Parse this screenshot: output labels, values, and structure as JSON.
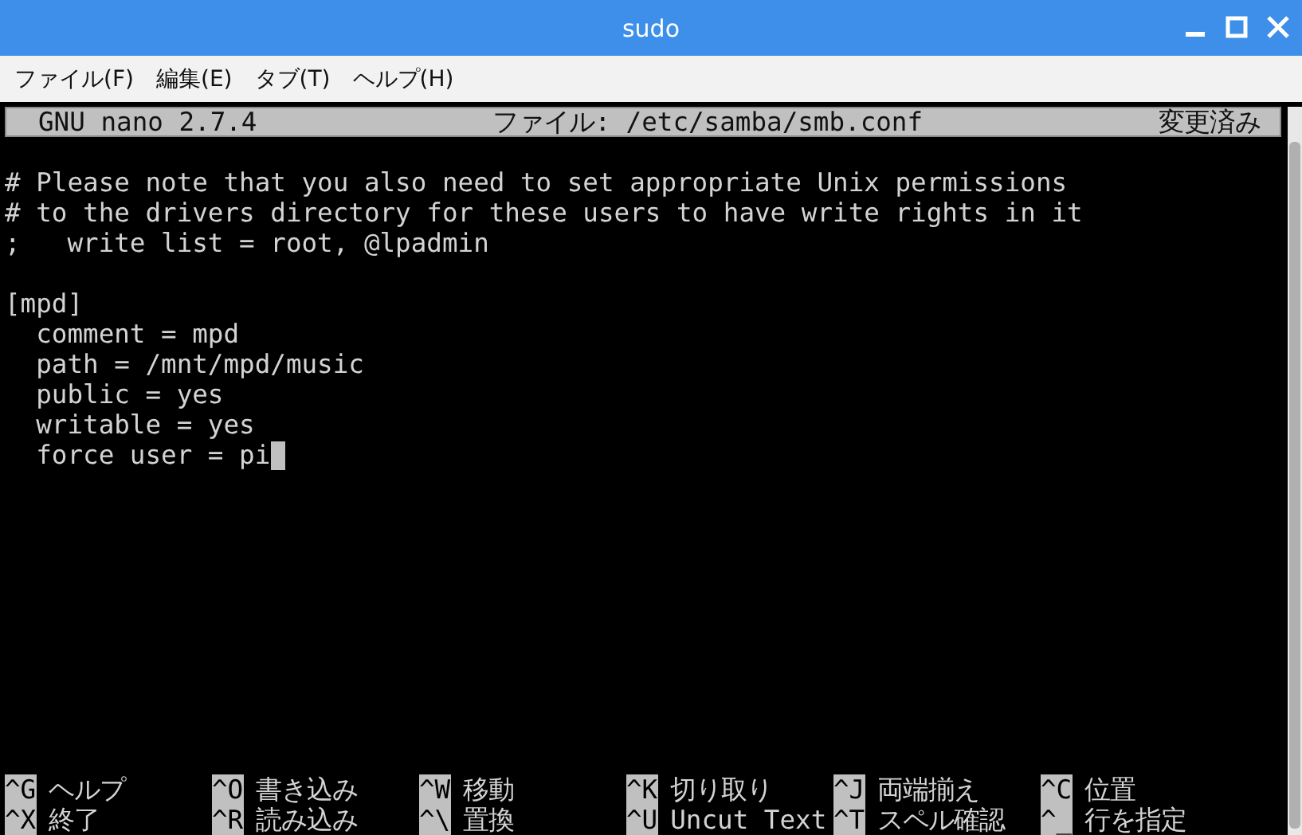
{
  "window": {
    "title": "sudo"
  },
  "menu_bar": [
    "ファイル(F)",
    "編集(E)",
    "タブ(T)",
    "ヘルプ(H)"
  ],
  "nano_header": {
    "version": "GNU nano 2.7.4",
    "file": "ファイル: /etc/samba/smb.conf",
    "status": "変更済み"
  },
  "editor": {
    "blocks": [
      {
        "lines": [
          {
            "text": "# Please note that you also need to set appropriate Unix permissions",
            "cursor": false
          },
          {
            "text": "# to the drivers directory for these users to have write rights in it",
            "cursor": false
          },
          {
            "text": ";   write list = root, @lpadmin",
            "cursor": false
          }
        ]
      },
      {
        "lines": [
          {
            "text": "[mpd]",
            "cursor": false
          },
          {
            "text": "  comment = mpd",
            "cursor": false
          },
          {
            "text": "  path = /mnt/mpd/music",
            "cursor": false
          },
          {
            "text": "  public = yes",
            "cursor": false
          },
          {
            "text": "  writable = yes",
            "cursor": false
          },
          {
            "text": "  force user = pi",
            "cursor": true
          }
        ]
      }
    ]
  },
  "shortcuts": [
    [
      {
        "key": "^G",
        "label": "ヘルプ"
      },
      {
        "key": "^O",
        "label": "書き込み"
      },
      {
        "key": "^W",
        "label": "移動"
      },
      {
        "key": "^K",
        "label": "切り取り"
      },
      {
        "key": "^J",
        "label": "両端揃え"
      },
      {
        "key": "^C",
        "label": "位置"
      }
    ],
    [
      {
        "key": "^X",
        "label": "終了"
      },
      {
        "key": "^R",
        "label": "読み込み"
      },
      {
        "key": "^\\",
        "label": "置換"
      },
      {
        "key": "^U",
        "label": "Uncut Text"
      },
      {
        "key": "^T",
        "label": "スペル確認"
      },
      {
        "key": "^_",
        "label": "行を指定"
      }
    ]
  ]
}
